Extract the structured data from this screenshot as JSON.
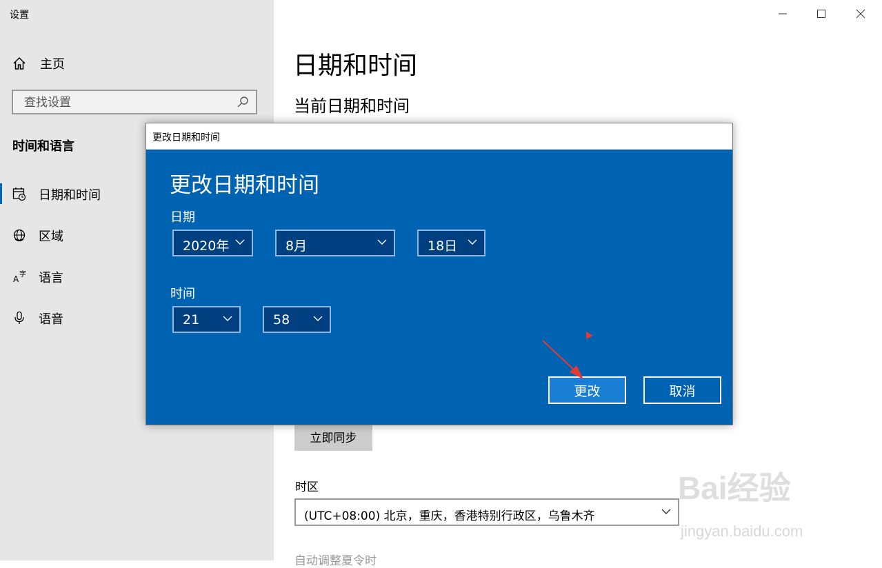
{
  "window": {
    "title": "设置"
  },
  "sidebar": {
    "home_label": "主页",
    "search_placeholder": "查找设置",
    "section_title": "时间和语言",
    "items": [
      {
        "label": "日期和时间",
        "icon": "calendar-clock-icon",
        "active": true
      },
      {
        "label": "区域",
        "icon": "globe-icon",
        "active": false
      },
      {
        "label": "语言",
        "icon": "language-icon",
        "active": false
      },
      {
        "label": "语音",
        "icon": "microphone-icon",
        "active": false
      }
    ]
  },
  "main": {
    "title": "日期和时间",
    "subtitle": "当前日期和时间",
    "sync_button": "立即同步",
    "timezone_label": "时区",
    "timezone_value": "(UTC+08:00) 北京，重庆，香港特别行政区，乌鲁木齐",
    "dst_label": "自动调整夏令时"
  },
  "dialog": {
    "window_title": "更改日期和时间",
    "heading": "更改日期和时间",
    "date_label": "日期",
    "year": "2020年",
    "month": "8月",
    "day": "18日",
    "time_label": "时间",
    "hour": "21",
    "minute": "58",
    "change_button": "更改",
    "cancel_button": "取消"
  },
  "watermark": {
    "logo_text": "Bai经验",
    "url": "jingyan.baidu.com"
  },
  "colors": {
    "dialog_bg": "#0063b1",
    "accent": "#0067b8",
    "annotation_arrow": "#e53935"
  }
}
